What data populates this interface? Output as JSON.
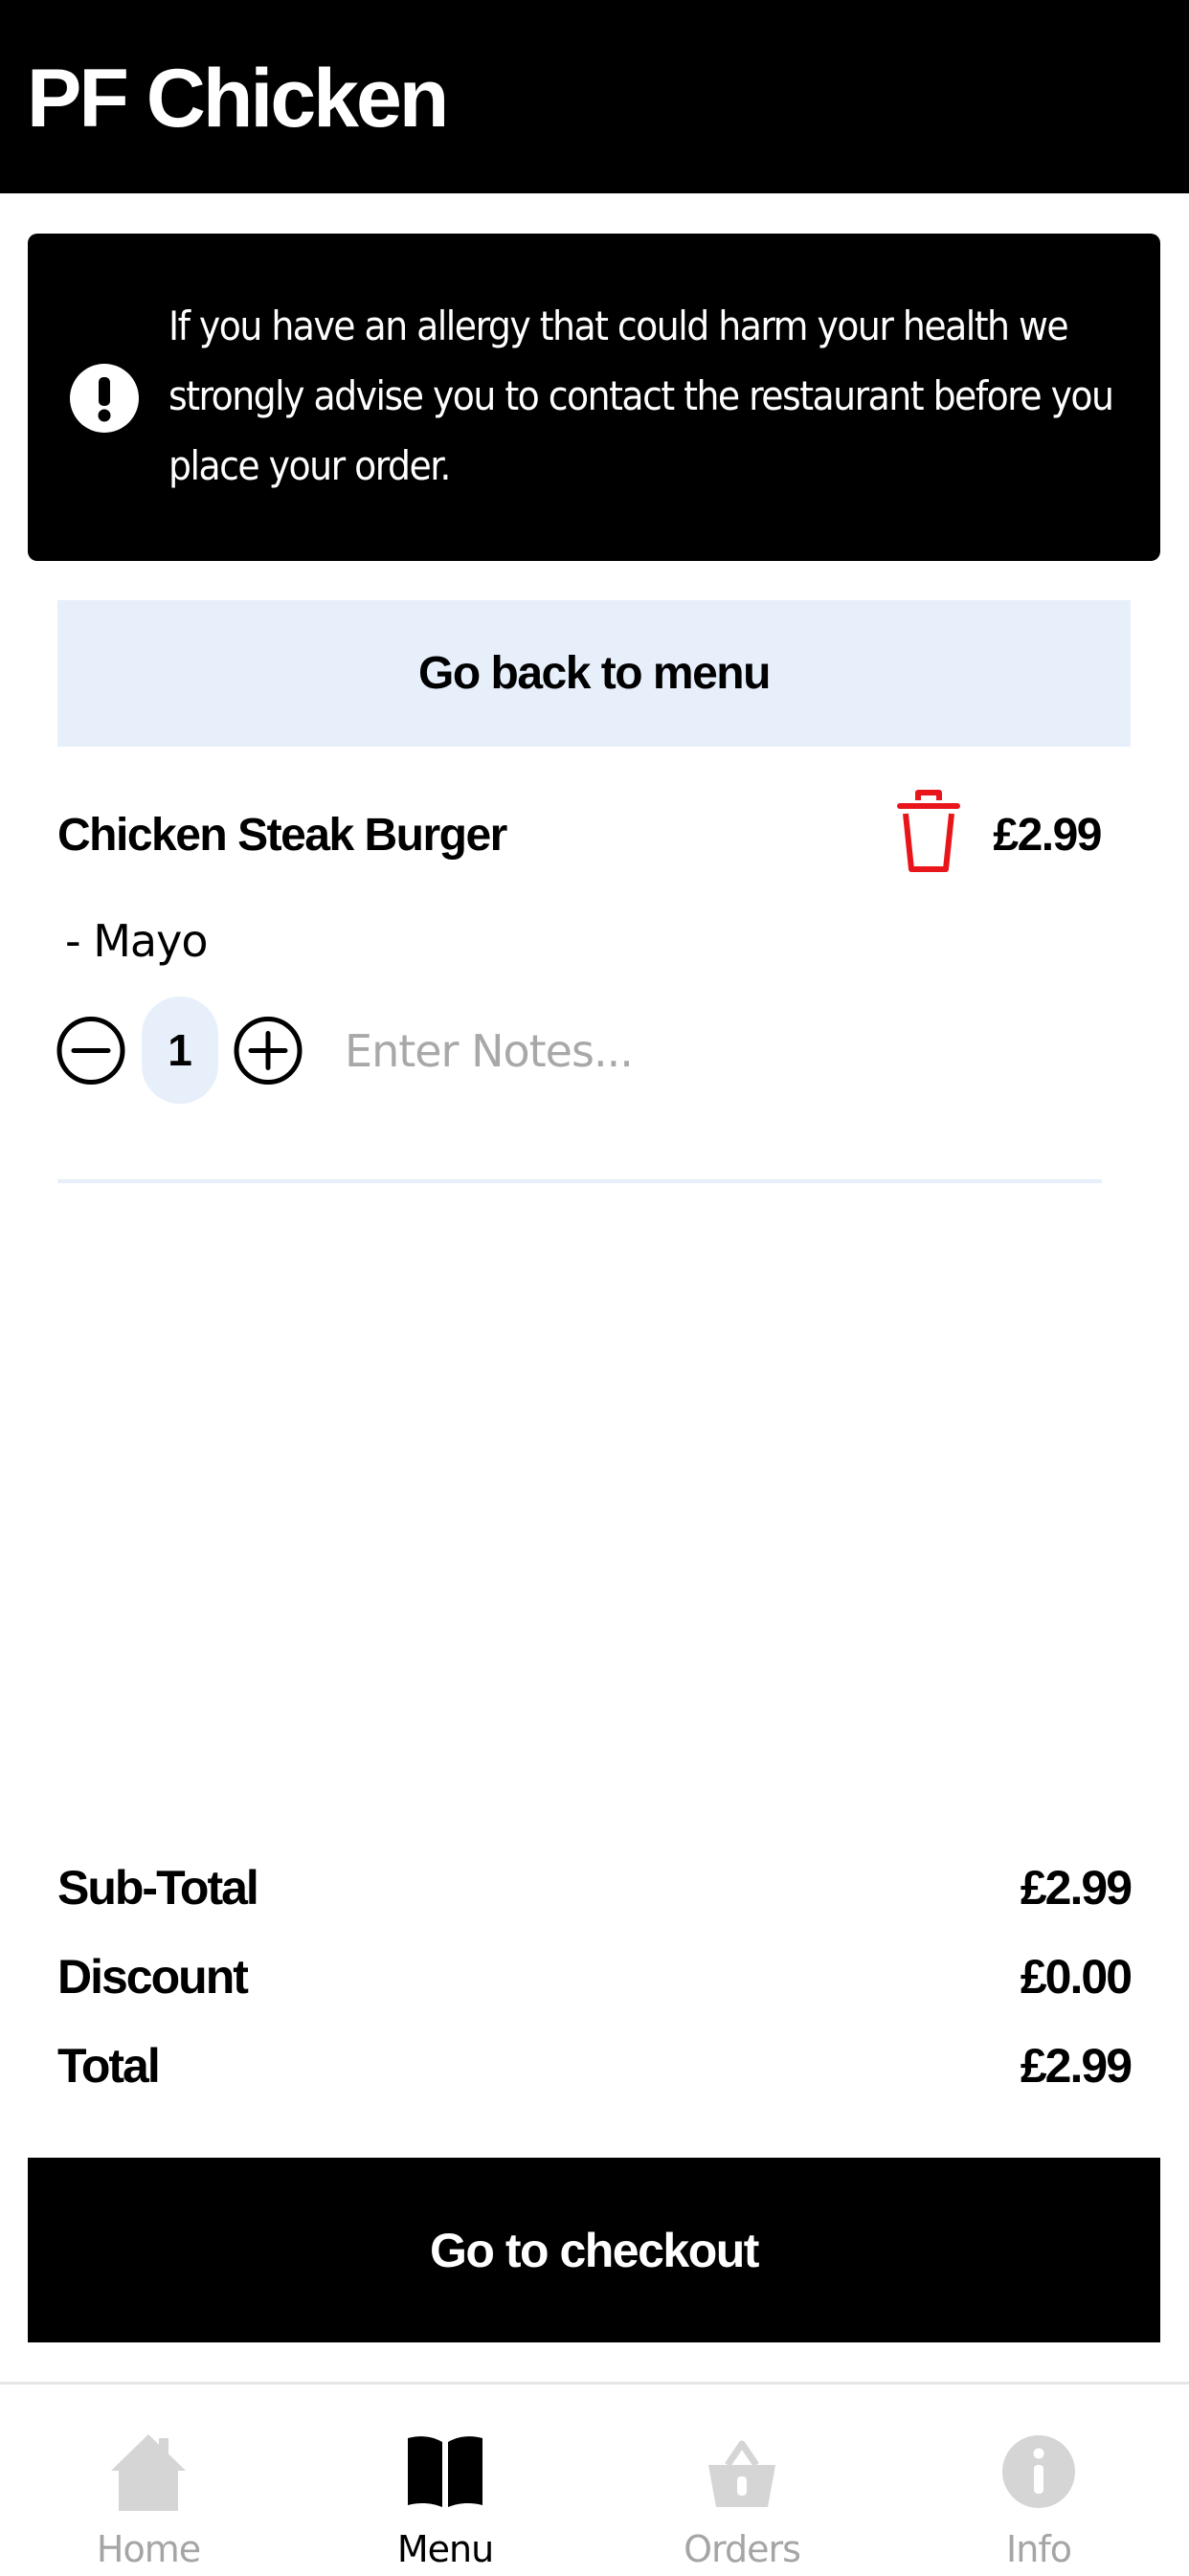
{
  "header": {
    "title": "PF Chicken"
  },
  "allergy_notice": {
    "icon": "exclamation-circle-icon",
    "text": "If you have an allergy that could harm your health we strongly advise you to contact the restaurant before you place your order."
  },
  "back_button": {
    "label": "Go back to menu"
  },
  "basket": {
    "items": [
      {
        "name": "Chicken Steak Burger",
        "price": "£2.99",
        "modifier": "- Mayo",
        "quantity": "1",
        "notes_value": "",
        "notes_placeholder": "Enter Notes..."
      }
    ]
  },
  "summary": {
    "subtotal_label": "Sub-Total",
    "subtotal_value": "£2.99",
    "discount_label": "Discount",
    "discount_value": "£0.00",
    "total_label": "Total",
    "total_value": "£2.99"
  },
  "checkout_button": {
    "label": "Go to checkout"
  },
  "tabs": [
    {
      "label": "Home",
      "icon": "home-icon",
      "active": false
    },
    {
      "label": "Menu",
      "icon": "book-icon",
      "active": true
    },
    {
      "label": "Orders",
      "icon": "basket-icon",
      "active": false
    },
    {
      "label": "Info",
      "icon": "info-icon",
      "active": false
    }
  ],
  "colors": {
    "header_bg": "#000000",
    "accent_light": "#e7effb",
    "delete": "#e8161b",
    "tab_inactive": "#a5a5a5"
  }
}
